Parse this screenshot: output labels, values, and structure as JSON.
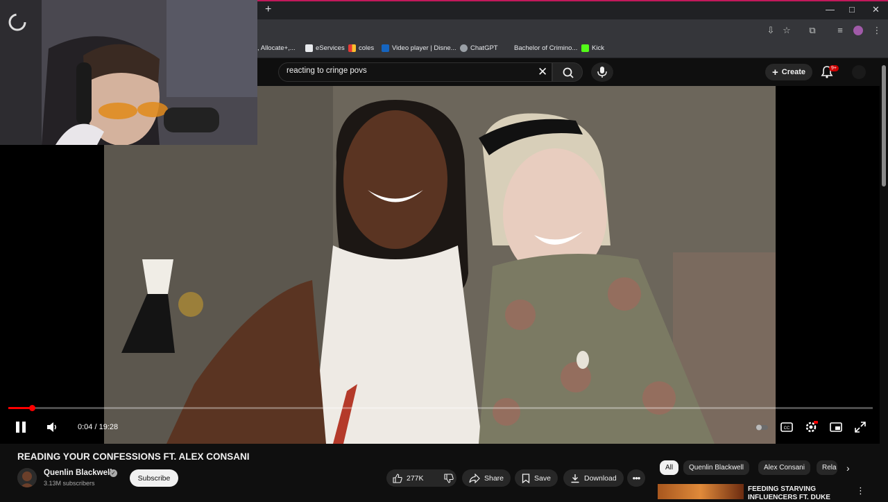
{
  "browser": {
    "new_tab": "+",
    "window_controls": {
      "minimize": "—",
      "maximize": "□",
      "close": "✕"
    },
    "bookmarks": [
      {
        "label": ", Allocate+,...",
        "icon_color": "#35363a"
      },
      {
        "label": "eServices",
        "icon_color": "#e8eaed"
      },
      {
        "label": "coles",
        "icon_color": "#e53935"
      },
      {
        "label": "Video player | Disne...",
        "icon_color": "#1565c0"
      },
      {
        "label": "ChatGPT",
        "icon_color": "#9aa0a6"
      },
      {
        "label": "Bachelor of Crimino...",
        "icon_color": "#35363a"
      },
      {
        "label": "Kick",
        "icon_color": "#53fc18"
      }
    ]
  },
  "youtube": {
    "search": {
      "query": "reacting to cringe povs"
    },
    "create_label": "Create",
    "notification_badge": "9+"
  },
  "player": {
    "timecode": "0:04 / 19:28",
    "progress_fraction": 0.0034
  },
  "video": {
    "title": "READING YOUR CONFESSIONS FT. ALEX CONSANI",
    "channel": "Quenlin Blackwell",
    "subscribers": "3.13M subscribers",
    "subscribe_label": "Subscribe",
    "likes": "277K",
    "actions": {
      "share": "Share",
      "save": "Save",
      "download": "Download"
    }
  },
  "sidebar": {
    "chips": [
      "All",
      "Quenlin Blackwell",
      "Alex Consani",
      "Rela"
    ],
    "recommendation": {
      "title": "FEEDING STARVING INFLUENCERS FT. DUKE"
    }
  },
  "colors": {
    "accent_red": "#ff0000",
    "background": "#0f0f0f",
    "pill": "#272727"
  }
}
